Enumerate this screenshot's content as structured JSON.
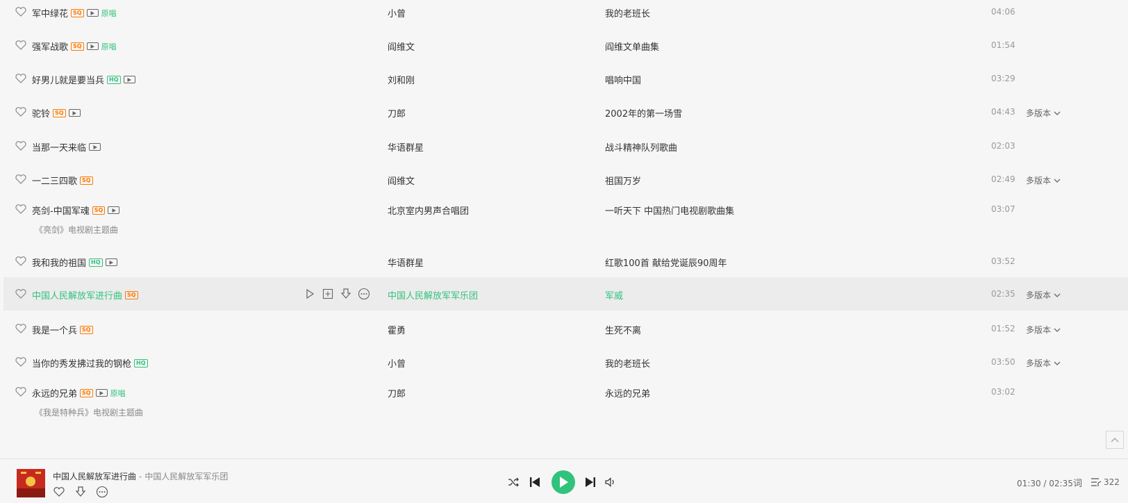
{
  "songs": [
    {
      "title": "军中绿花",
      "badges": [
        "SQ",
        "MV",
        "原唱"
      ],
      "artist": "小曾",
      "album": "我的老班长",
      "duration": "04:06",
      "multi": "",
      "subtitle": ""
    },
    {
      "title": "强军战歌",
      "badges": [
        "SQ",
        "MV",
        "原唱"
      ],
      "artist": "阎维文",
      "album": "阎维文单曲集",
      "duration": "01:54",
      "multi": "",
      "subtitle": ""
    },
    {
      "title": "好男儿就是要当兵",
      "badges": [
        "HQ",
        "MV"
      ],
      "artist": "刘和刚",
      "album": "唱响中国",
      "duration": "03:29",
      "multi": "",
      "subtitle": ""
    },
    {
      "title": "驼铃",
      "badges": [
        "SQ",
        "MV"
      ],
      "artist": "刀郎",
      "album": "2002年的第一场雪",
      "duration": "04:43",
      "multi": "多版本",
      "subtitle": ""
    },
    {
      "title": "当那一天来临",
      "badges": [
        "MV"
      ],
      "artist": "华语群星",
      "album": "战斗精神队列歌曲",
      "duration": "02:03",
      "multi": "",
      "subtitle": ""
    },
    {
      "title": "一二三四歌",
      "badges": [
        "SQ"
      ],
      "artist": "阎维文",
      "album": "祖国万岁",
      "duration": "02:49",
      "multi": "多版本",
      "subtitle": ""
    },
    {
      "title": "亮剑-中国军魂",
      "badges": [
        "SQ",
        "MV"
      ],
      "artist": "北京室内男声合唱团",
      "album": "一听天下 中国热门电视剧歌曲集",
      "duration": "03:07",
      "multi": "",
      "subtitle": "《亮剑》电视剧主题曲"
    },
    {
      "title": "我和我的祖国",
      "badges": [
        "HQ",
        "MV"
      ],
      "artist": "华语群星",
      "album": "红歌100首 献给党诞辰90周年",
      "duration": "03:52",
      "multi": "",
      "subtitle": ""
    },
    {
      "title": "中国人民解放军进行曲",
      "badges": [
        "SQ"
      ],
      "artist": "中国人民解放军军乐团",
      "album": "军威",
      "duration": "02:35",
      "multi": "多版本",
      "subtitle": ""
    },
    {
      "title": "我是一个兵",
      "badges": [
        "SQ"
      ],
      "artist": "霍勇",
      "album": "生死不离",
      "duration": "01:52",
      "multi": "多版本",
      "subtitle": ""
    },
    {
      "title": "当你的秀发拂过我的钢枪",
      "badges": [
        "HQ"
      ],
      "artist": "小曾",
      "album": "我的老班长",
      "duration": "03:50",
      "multi": "多版本",
      "subtitle": ""
    },
    {
      "title": "永远的兄弟",
      "badges": [
        "SQ",
        "MV",
        "原唱"
      ],
      "artist": "刀郎",
      "album": "永远的兄弟",
      "duration": "03:02",
      "multi": "",
      "subtitle": "《我是特种兵》电视剧主题曲"
    }
  ],
  "active_index": 8,
  "player": {
    "title": "中国人民解放军进行曲",
    "separator": "-",
    "artist": "中国人民解放军军乐团",
    "time": "01:30 / 02:35",
    "lyric_label": "词",
    "queue_count": "322"
  },
  "colors": {
    "accent": "#31c27c",
    "sq": "#ff7800",
    "background": "#f6f6f6",
    "active_row": "#ececec"
  }
}
